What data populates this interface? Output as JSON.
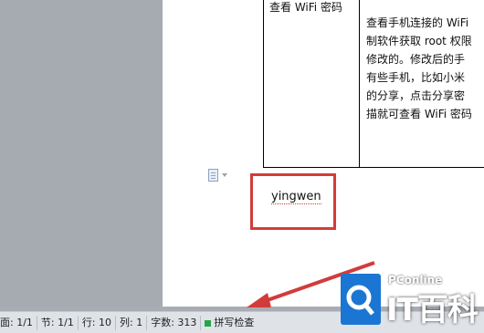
{
  "document": {
    "table": {
      "left_cell": "查看 WiFi 密码",
      "right_cell_lines": [
        "查看手机连接的 WiFi",
        "制软件获取 root 权限",
        "修改的。修改后的手",
        "有些手机，比如小米",
        "的分享，点击分享密",
        "描就可查看 WiFi 密码"
      ]
    },
    "highlight_text": "yingwen"
  },
  "statusbar": {
    "page": "面: 1/1",
    "section": "节: 1/1",
    "line": "行: 10",
    "column": "列: 1",
    "word_count": "字数: 313",
    "spell_check": "拼写检查",
    "spell_check_color": "#25a547"
  },
  "watermark": {
    "brand_small": "PConline",
    "brand_main": "IT百科",
    "brand_color": "#1a76d2"
  },
  "annotation_color": "#d33b3b"
}
